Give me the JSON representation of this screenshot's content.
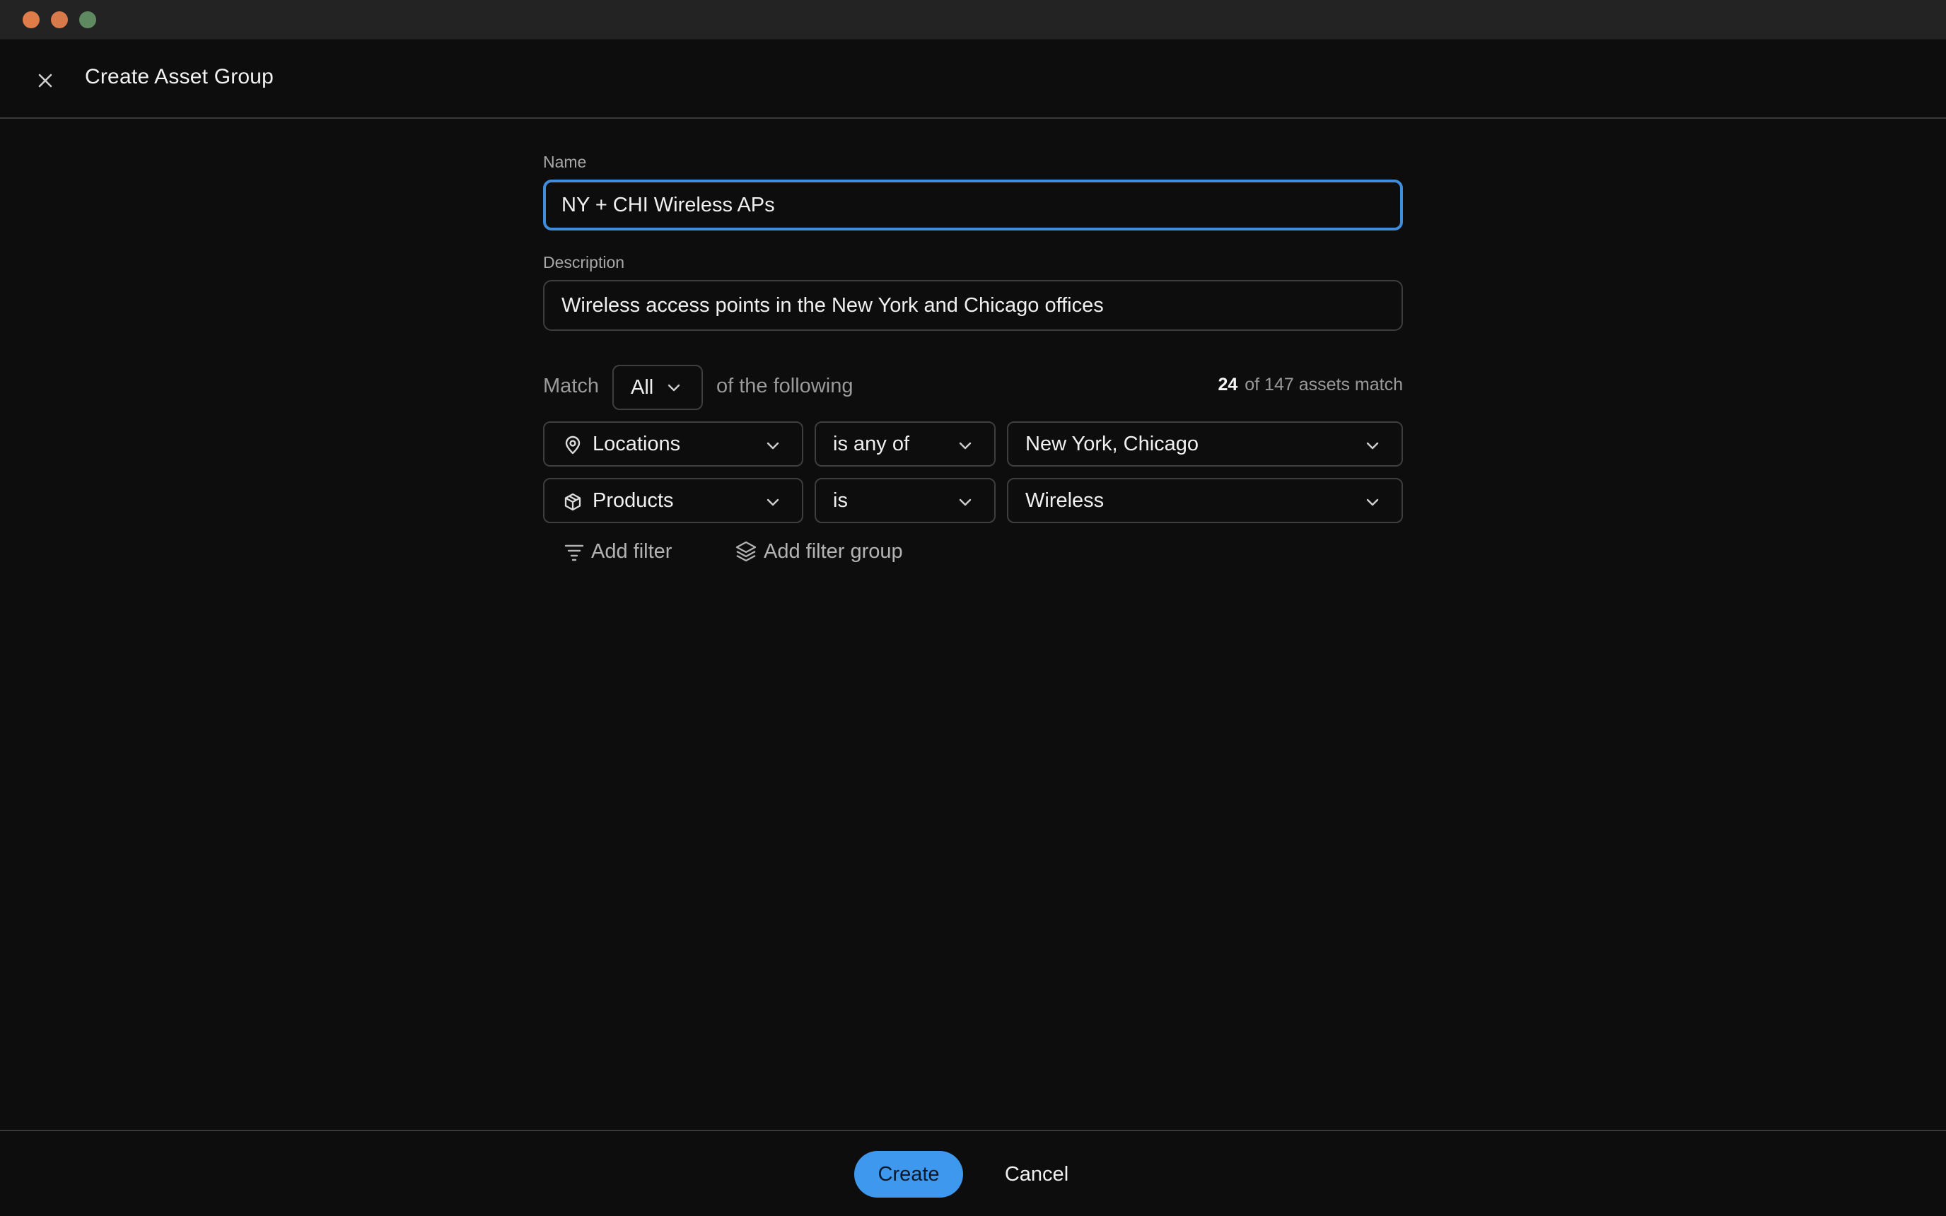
{
  "window": {
    "colors": {
      "background": "#0d0d0d",
      "accent": "#3f8ddb",
      "primary_button": "#3d98ee"
    }
  },
  "header": {
    "title": "Create Asset Group",
    "close_icon": "close-icon"
  },
  "form": {
    "name": {
      "label": "Name",
      "value": "NY + CHI Wireless APs"
    },
    "description": {
      "label": "Description",
      "value": "Wireless access points in the New York and Chicago offices"
    },
    "match": {
      "label": "Match",
      "selected": "All",
      "suffix": "of the following",
      "count": "24",
      "count_suffix": "of 147 assets match"
    },
    "filters": [
      {
        "field_icon": "location-pin-icon",
        "field": "Locations",
        "operator": "is any of",
        "value": "New York, Chicago"
      },
      {
        "field_icon": "package-icon",
        "field": "Products",
        "operator": "is",
        "value": "Wireless"
      }
    ],
    "add_filter_label": "Add filter",
    "add_filter_group_label": "Add filter group"
  },
  "footer": {
    "create_label": "Create",
    "cancel_label": "Cancel"
  }
}
